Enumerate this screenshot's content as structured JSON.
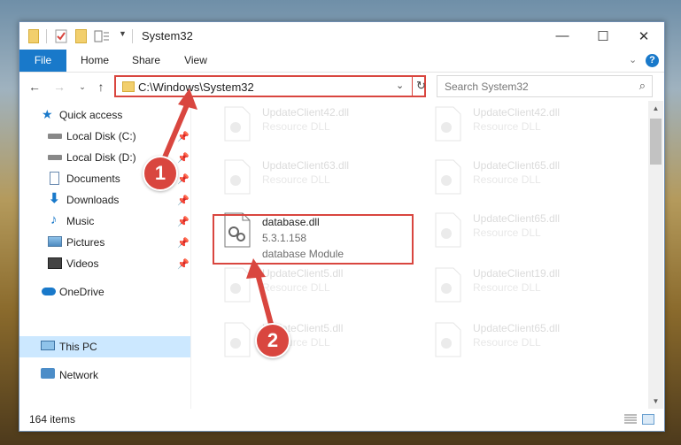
{
  "window": {
    "title": "System32",
    "controls": {
      "minimize": "—",
      "maximize": "☐",
      "close": "✕"
    }
  },
  "ribbon": {
    "tabs": [
      {
        "label": "File"
      },
      {
        "label": "Home"
      },
      {
        "label": "Share"
      },
      {
        "label": "View"
      }
    ]
  },
  "navigation": {
    "address_path": "C:\\Windows\\System32",
    "search_placeholder": "Search System32"
  },
  "sidebar": {
    "items": [
      {
        "label": "Quick access",
        "icon": "star-icon"
      },
      {
        "label": "Local Disk (C:)",
        "icon": "drive-icon"
      },
      {
        "label": "Local Disk (D:)",
        "icon": "drive-icon"
      },
      {
        "label": "Documents",
        "icon": "documents-icon"
      },
      {
        "label": "Downloads",
        "icon": "download-icon"
      },
      {
        "label": "Music",
        "icon": "music-icon"
      },
      {
        "label": "Pictures",
        "icon": "pictures-icon"
      },
      {
        "label": "Videos",
        "icon": "videos-icon"
      },
      {
        "label": "OneDrive",
        "icon": "cloud-icon"
      },
      {
        "label": "This PC",
        "icon": "computer-icon"
      },
      {
        "label": "Network",
        "icon": "network-icon"
      }
    ]
  },
  "files": {
    "highlighted": {
      "name": "database.dll",
      "version": "5.3.1.158",
      "description": "database Module"
    },
    "background": [
      {
        "name": "UpdateClient42.dll",
        "type": "Resource DLL"
      },
      {
        "name": "UpdateClient42.dll",
        "type": "Resource DLL"
      },
      {
        "name": "UpdateClient63.dll",
        "type": "Resource DLL"
      },
      {
        "name": "UpdateClient65.dll",
        "type": "Resource DLL"
      },
      {
        "name": "UpdateClient65.dll",
        "type": "Resource DLL"
      },
      {
        "name": "UpdateClient5.dll",
        "type": "Resource DLL"
      },
      {
        "name": "UpdateClient19.dll",
        "type": "Resource DLL"
      },
      {
        "name": "UpdateClient5.dll",
        "type": "Resource DLL"
      },
      {
        "name": "UpdateClient65.dll",
        "type": "Resource DLL"
      }
    ]
  },
  "status": {
    "item_count": "164 items"
  },
  "annotations": {
    "step1": "1",
    "step2": "2",
    "color": "#d9463f"
  }
}
